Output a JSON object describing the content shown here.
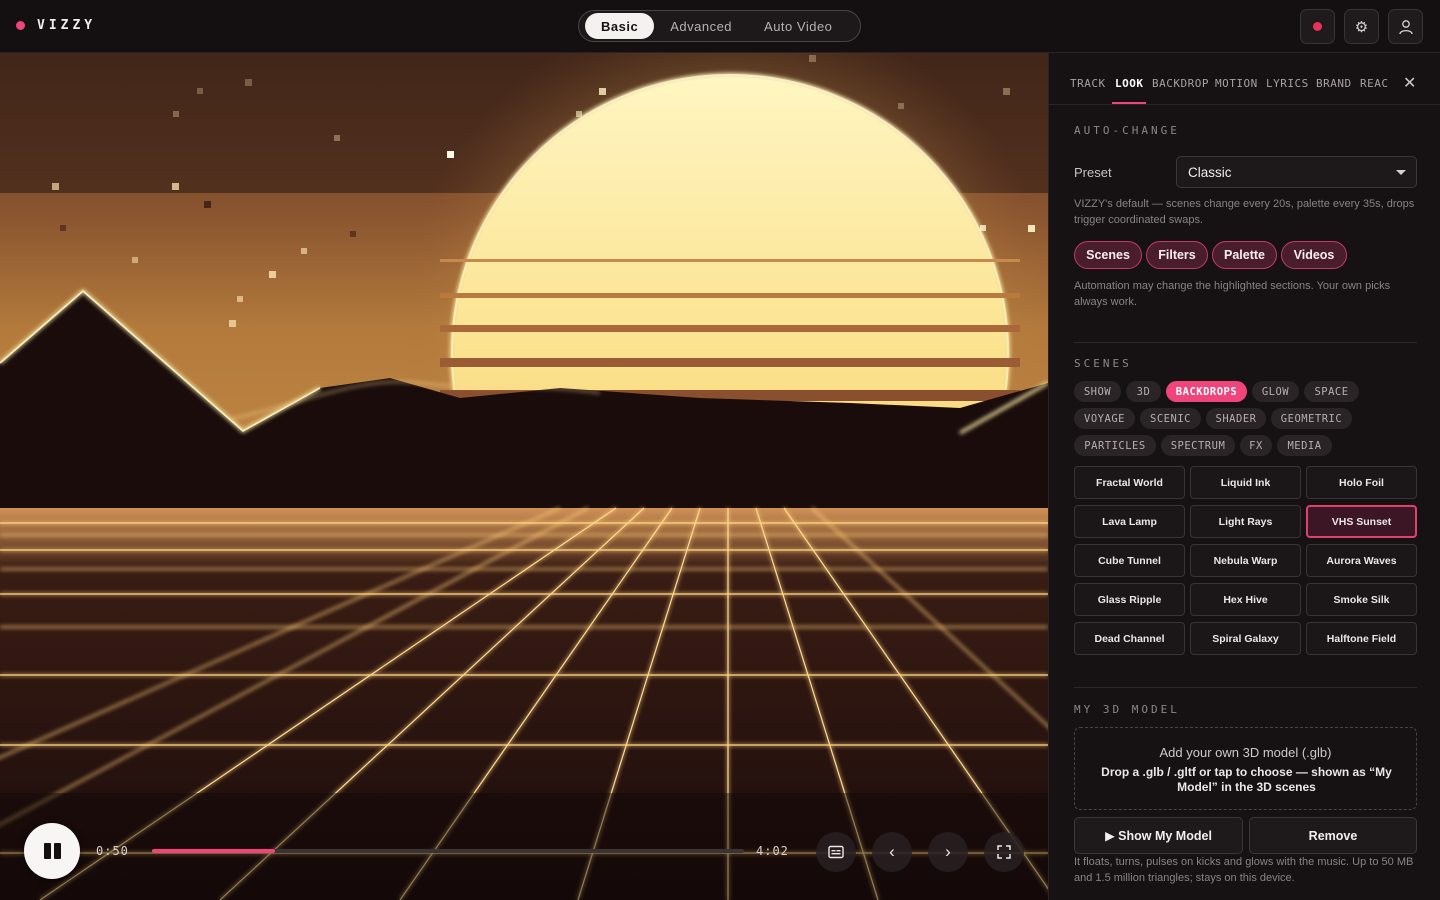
{
  "app": {
    "name": "VIZZY"
  },
  "modes": {
    "items": [
      "Basic",
      "Advanced",
      "Auto Video"
    ],
    "active": "Basic"
  },
  "header_icons": [
    "record-icon",
    "gear-icon",
    "user-icon"
  ],
  "player": {
    "current_time": "0:50",
    "total_time": "4:02",
    "progress": 0.207,
    "controls": [
      "pause-icon",
      "captions-icon",
      "chevron-left-icon",
      "chevron-right-icon",
      "fullscreen-icon"
    ]
  },
  "panel": {
    "tabs": [
      "TRACK",
      "LOOK",
      "BACKDROP",
      "MOTION",
      "LYRICS",
      "BRAND",
      "REAC"
    ],
    "active_tab": "LOOK",
    "auto_change": {
      "title": "AUTO-CHANGE",
      "preset_label": "Preset",
      "preset_value": "Classic",
      "description": "VIZZY's default — scenes change every 20s, palette every 35s, drops trigger coordinated swaps.",
      "pills": [
        "Scenes",
        "Filters",
        "Palette",
        "Videos"
      ],
      "note": "Automation may change the highlighted sections. Your own picks always work."
    },
    "scenes": {
      "title": "SCENES",
      "categories": [
        "SHOW",
        "3D",
        "BACKDROPS",
        "GLOW",
        "SPACE",
        "VOYAGE",
        "SCENIC",
        "SHADER",
        "GEOMETRIC",
        "PARTICLES",
        "SPECTRUM",
        "FX",
        "MEDIA"
      ],
      "active_category": "BACKDROPS",
      "items": [
        "Fractal World",
        "Liquid Ink",
        "Holo Foil",
        "Lava Lamp",
        "Light Rays",
        "VHS Sunset",
        "Cube Tunnel",
        "Nebula Warp",
        "Aurora Waves",
        "Glass Ripple",
        "Hex Hive",
        "Smoke Silk",
        "Dead Channel",
        "Spiral Galaxy",
        "Halftone Field"
      ],
      "active_item": "VHS Sunset"
    },
    "model": {
      "title": "MY 3D MODEL",
      "drop_title": "Add your own 3D model (.glb)",
      "drop_sub": "Drop a .glb / .gltf or tap to choose — shown as “My Model” in the 3D scenes",
      "show_label": "▶ Show My Model",
      "remove_label": "Remove",
      "note": "It floats, turns, pulses on kicks and glows with the music. Up to 50 MB and 1.5 million triangles; stays on this device."
    }
  }
}
